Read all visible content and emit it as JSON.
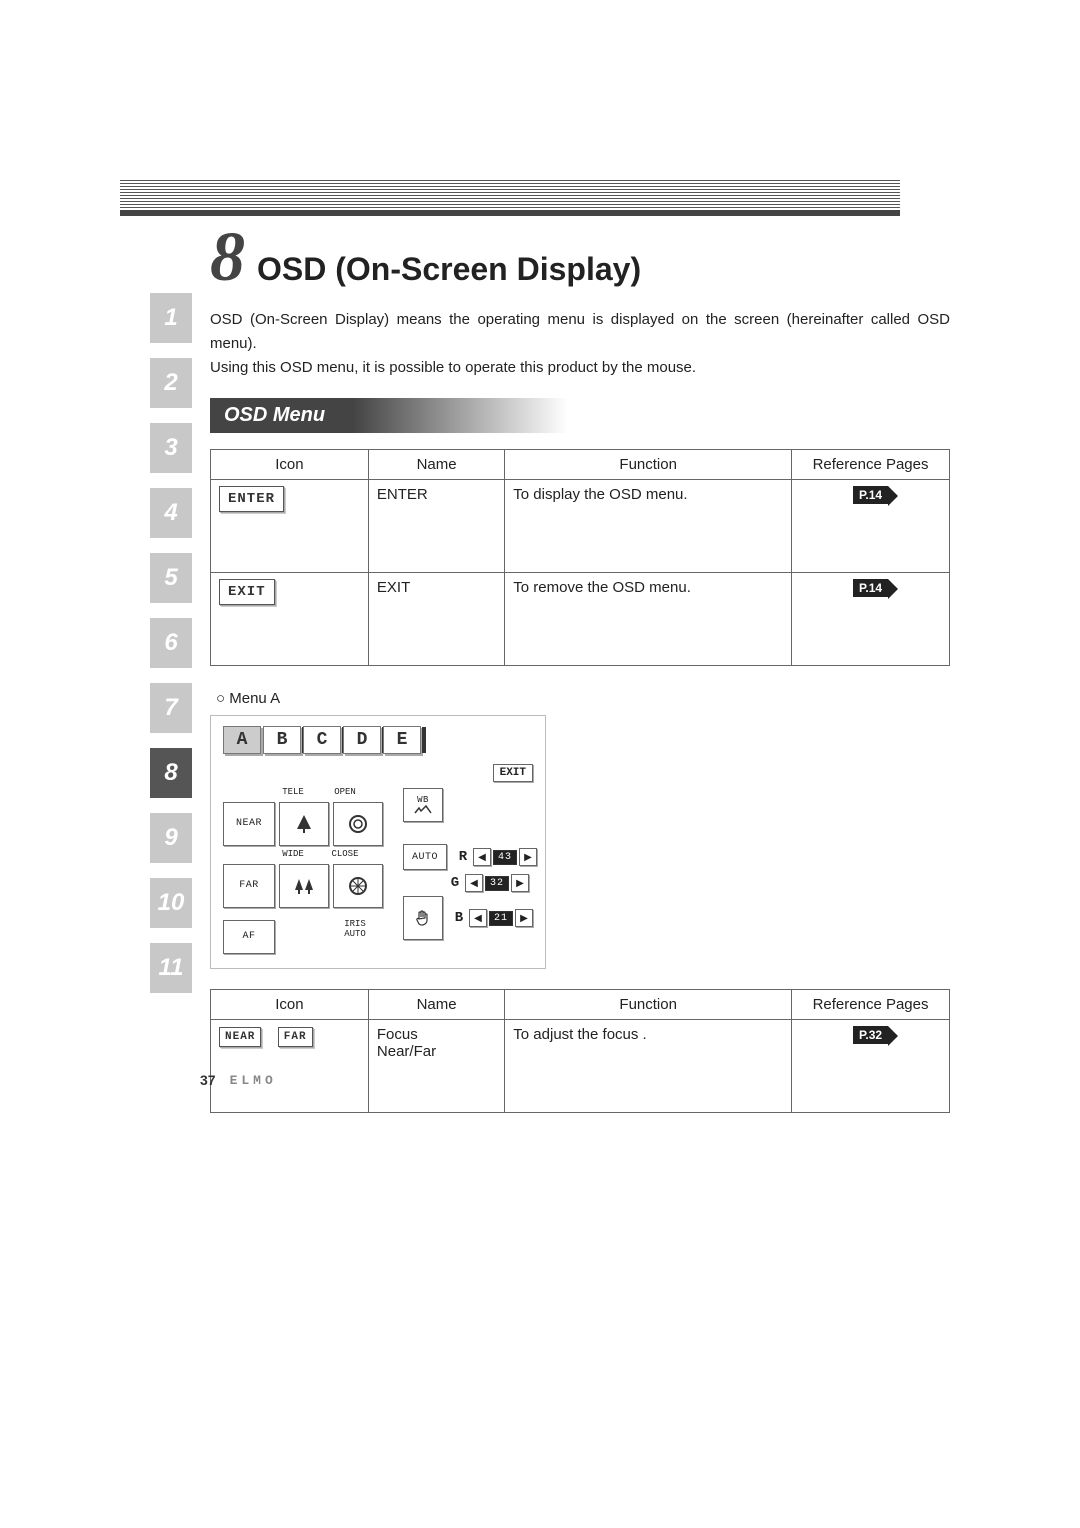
{
  "chapter": {
    "number": "8",
    "title": "OSD (On-Screen Display)"
  },
  "intro": {
    "line1": "OSD (On-Screen Display) means the operating menu is displayed on the screen (hereinafter called OSD menu).",
    "line2": "Using this OSD menu, it is possible to operate this product by the mouse."
  },
  "section_title": "OSD Menu",
  "table1": {
    "headers": {
      "icon": "Icon",
      "name": "Name",
      "function": "Function",
      "ref": "Reference Pages"
    },
    "rows": [
      {
        "icon_label": "ENTER",
        "name": "ENTER",
        "function": "To display the OSD menu.",
        "ref": "P.14"
      },
      {
        "icon_label": "EXIT",
        "name": "EXIT",
        "function": "To remove the OSD menu.",
        "ref": "P.14"
      }
    ]
  },
  "menu_a_label": "○ Menu A",
  "menu_a": {
    "tabs": [
      "A",
      "B",
      "C",
      "D",
      "E"
    ],
    "exit": "EXIT",
    "tele": "TELE",
    "open_": "OPEN",
    "near": "NEAR",
    "wide": "WIDE",
    "close_": "CLOSE",
    "far": "FAR",
    "af": "AF",
    "iris_auto": "IRIS\nAUTO",
    "wb": "WB",
    "auto": "AUTO",
    "rgb": {
      "r_label": "R",
      "r_val": "43",
      "g_label": "G",
      "g_val": "32",
      "b_label": "B",
      "b_val": "21"
    }
  },
  "table2": {
    "headers": {
      "icon": "Icon",
      "name": "Name",
      "function": "Function",
      "ref": "Reference Pages"
    },
    "rows": [
      {
        "icon_near": "NEAR",
        "icon_far": "FAR",
        "name": "Focus\nNear/Far",
        "function": "To adjust the focus .",
        "ref": "P.32"
      }
    ]
  },
  "sidebar": [
    "1",
    "2",
    "3",
    "4",
    "5",
    "6",
    "7",
    "8",
    "9",
    "10",
    "11"
  ],
  "sidebar_active": "8",
  "page_number": "37",
  "brand": "ELMO",
  "arrows": {
    "left": "◀",
    "right": "▶"
  }
}
